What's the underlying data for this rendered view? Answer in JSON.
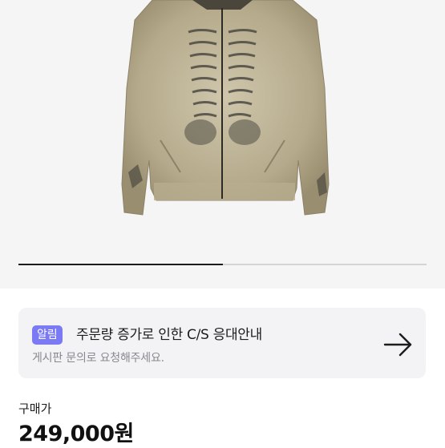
{
  "product_image": {
    "carousel_progress": 0.5
  },
  "notice": {
    "badge": "알림",
    "title": "주문량 증가로 인한 C/S 응대안내",
    "subtitle": "게시판 문의로 요청해주세요.",
    "arrow_icon": "arrow-right-icon",
    "badge_color": "#7a7af5"
  },
  "price": {
    "label": "구매가",
    "value": "249,000원"
  }
}
